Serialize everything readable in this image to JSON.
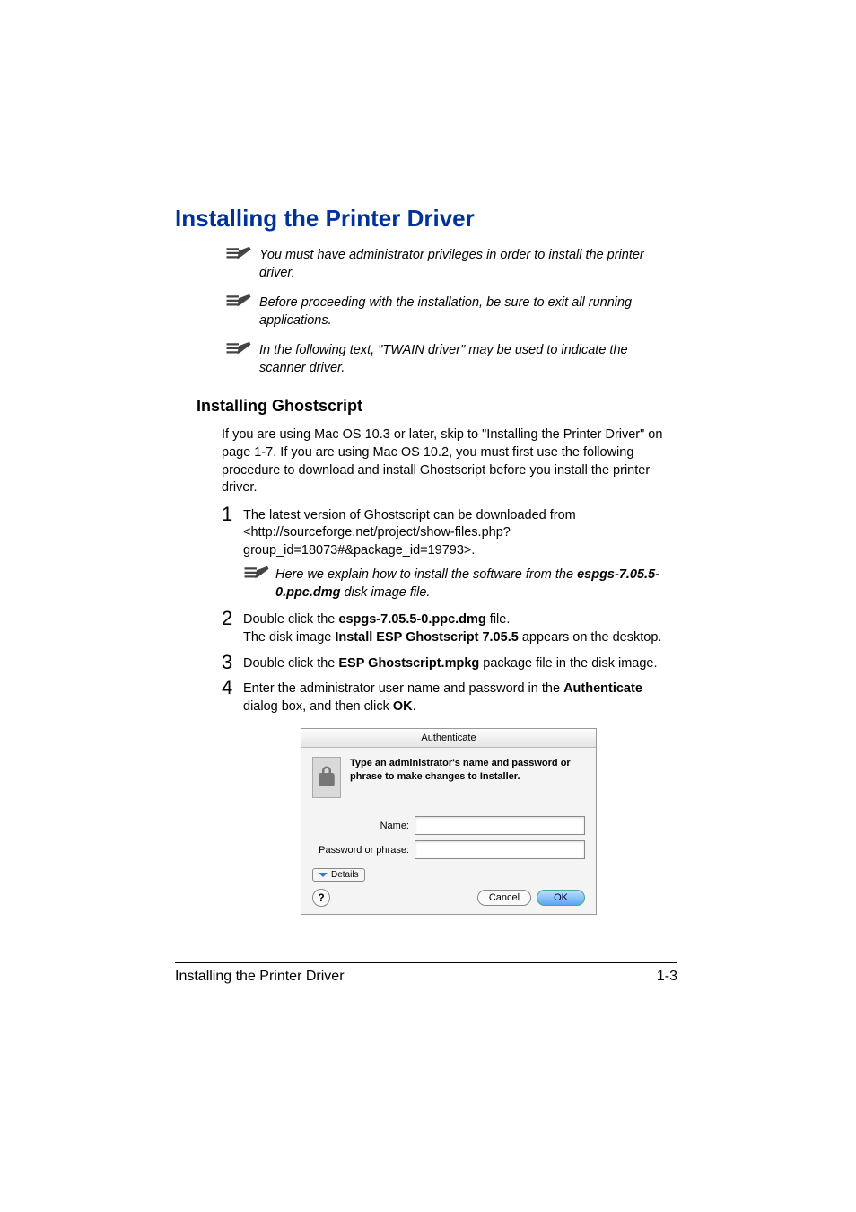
{
  "heading": "Installing the Printer Driver",
  "notes": {
    "n1": "You must have administrator privileges in order to install the printer driver.",
    "n2": "Before proceeding with the installation, be sure to exit all running applications.",
    "n3": "In the following text, \"TWAIN driver\" may be used to indicate the scanner driver."
  },
  "subheading": "Installing Ghostscript",
  "intro": "If you are using Mac OS 10.3 or later, skip to \"Installing the Printer Driver\" on page 1-7. If you are using Mac OS 10.2, you must first use the following procedure to download and install Ghostscript before you install the printer driver.",
  "steps": {
    "s1": {
      "num": "1",
      "text": "The latest version of Ghostscript can be downloaded from <http://sourceforge.net/project/show-files.php?group_id=18073#&package_id=19793>."
    },
    "subnote": {
      "pre": "Here we explain how to install the software from the ",
      "bold": "espgs-7.05.5-0.ppc.dmg",
      "post": " disk image file."
    },
    "s2": {
      "num": "2",
      "line1a": "Double click the ",
      "line1b": "espgs-7.05.5-0.ppc.dmg",
      "line1c": " file.",
      "line2a": "The disk image ",
      "line2b": "Install ESP Ghostscript 7.05.5",
      "line2c": " appears on the desktop."
    },
    "s3": {
      "num": "3",
      "a": "Double click the ",
      "b": "ESP Ghostscript.mpkg",
      "c": " package file in the disk image."
    },
    "s4": {
      "num": "4",
      "a": "Enter the administrator user name and password in the ",
      "b": "Authenticate",
      "c": " dialog box, and then click ",
      "d": "OK",
      "e": "."
    }
  },
  "dialog": {
    "title": "Authenticate",
    "msg": "Type an administrator's name and password or phrase to make changes to Installer.",
    "nameLabel": "Name:",
    "passLabel": "Password or phrase:",
    "details": "Details",
    "help": "?",
    "cancel": "Cancel",
    "ok": "OK"
  },
  "footer": {
    "left": "Installing the Printer Driver",
    "right": "1-3"
  }
}
